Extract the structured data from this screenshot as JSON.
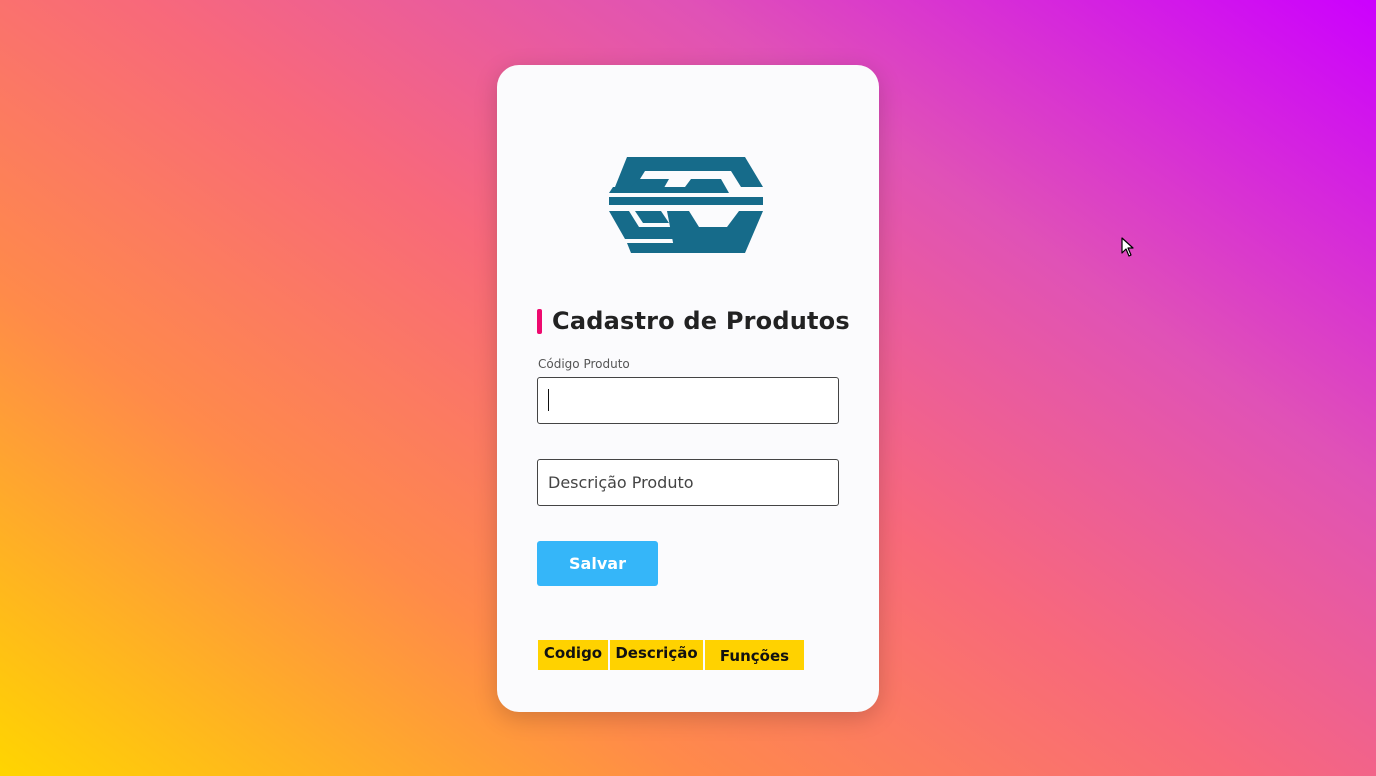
{
  "form": {
    "title": "Cadastro de Produtos",
    "code_label": "Código Produto",
    "code_value": "",
    "description_placeholder": "Descrição Produto",
    "save_label": "Salvar"
  },
  "table": {
    "headers": [
      "Codigo",
      "Descrição",
      "Funções"
    ]
  },
  "colors": {
    "accent": "#ee0a6f",
    "button": "#35b6f9",
    "table_header": "#ffd200",
    "logo": "#166b8a"
  },
  "icons": {
    "logo": "brand-logo",
    "cursor": "mouse-pointer"
  }
}
